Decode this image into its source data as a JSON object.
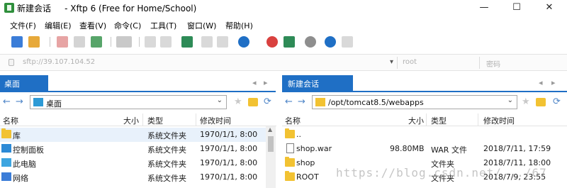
{
  "window": {
    "title": "新建会话     - Xftp 6 (Free for Home/School)",
    "controls": {
      "minimize": "—",
      "maximize": "☐",
      "close": "✕"
    }
  },
  "menu": [
    "文件(F)",
    "编辑(E)",
    "查看(V)",
    "命令(C)",
    "工具(T)",
    "窗口(W)",
    "帮助(H)"
  ],
  "address": {
    "host_placeholder": "sftp://39.107.104.52",
    "user_placeholder": "root",
    "password_placeholder": "密码"
  },
  "left_pane": {
    "tab_label": "桌面",
    "path": "桌面",
    "columns": {
      "name": "名称",
      "size": "大小",
      "type": "类型",
      "modified": "修改时间"
    },
    "rows": [
      {
        "name": "库",
        "size": "",
        "type": "系统文件夹",
        "modified": "1970/1/1, 8:00",
        "icon": "library-icon"
      },
      {
        "name": "控制面板",
        "size": "",
        "type": "系统文件夹",
        "modified": "1970/1/1, 8:00",
        "icon": "control-panel-icon"
      },
      {
        "name": "此电脑",
        "size": "",
        "type": "系统文件夹",
        "modified": "1970/1/1, 8:00",
        "icon": "computer-icon"
      },
      {
        "name": "网络",
        "size": "",
        "type": "系统文件夹",
        "modified": "1970/1/1, 8:00",
        "icon": "network-icon"
      }
    ]
  },
  "right_pane": {
    "tab_label": "新建会话",
    "path": "/opt/tomcat8.5/webapps",
    "columns": {
      "name": "名称",
      "size": "大小",
      "type": "类型",
      "modified": "修改时间"
    },
    "rows": [
      {
        "name": "..",
        "size": "",
        "type": "",
        "modified": "",
        "icon": "folder-icon"
      },
      {
        "name": "shop.war",
        "size": "98.80MB",
        "type": "WAR 文件",
        "modified": "2018/7/11, 17:59",
        "icon": "file-icon"
      },
      {
        "name": "shop",
        "size": "",
        "type": "文件夹",
        "modified": "2018/7/11, 18:00",
        "icon": "folder-icon"
      },
      {
        "name": "ROOT",
        "size": "",
        "type": "文件夹",
        "modified": "2018/7/9, 23:55",
        "icon": "folder-icon"
      }
    ]
  },
  "watermark": "https://blog.csdn.net/.../67",
  "colors": {
    "accent": "#1f6fc5",
    "selection": "#e8f1fb",
    "folder": "#f2c232"
  }
}
